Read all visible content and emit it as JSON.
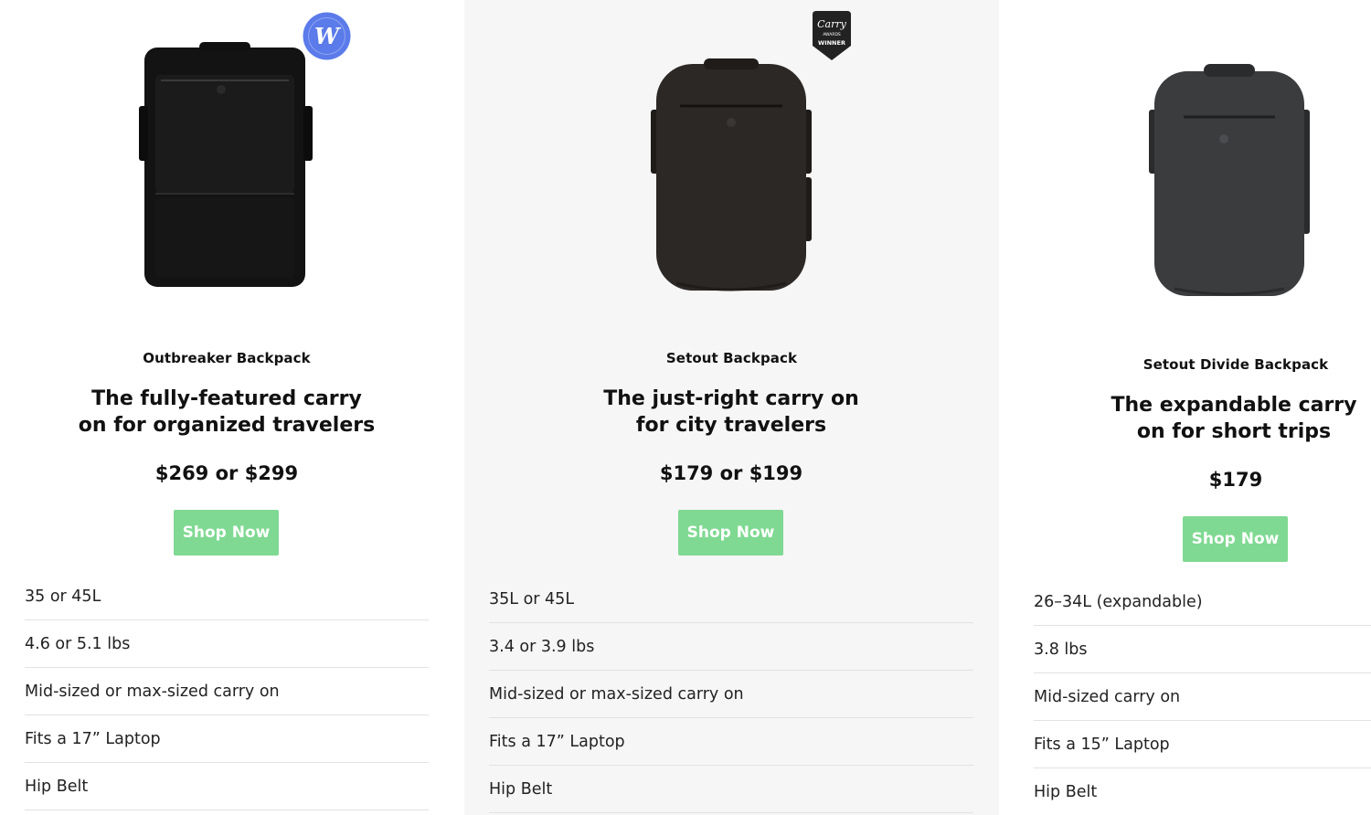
{
  "products": [
    {
      "name": "Outbreaker Backpack",
      "tagline": "The fully-featured carry on for organized travelers",
      "price": "$269 or $299",
      "button": "Shop Now",
      "badge": "W",
      "badge_icon": "award-w-icon",
      "specs": [
        "35 or 45L",
        "4.6 or 5.1 lbs",
        "Mid-sized or max-sized carry on",
        "Fits a 17” Laptop",
        "Hip Belt"
      ]
    },
    {
      "name": "Setout Backpack",
      "tagline": "The just-right carry on for city travelers",
      "price": "$179 or $199",
      "button": "Shop Now",
      "badge": {
        "line1": "Carry",
        "line2": "AWARDS",
        "line3": "WINNER"
      },
      "badge_icon": "carry-awards-shield-icon",
      "specs": [
        "35L or 45L",
        "3.4 or 3.9 lbs",
        "Mid-sized or max-sized carry on",
        "Fits a 17” Laptop",
        "Hip Belt"
      ]
    },
    {
      "name": "Setout Divide Backpack",
      "tagline": "The expandable carry on for short trips",
      "price": "$179",
      "button": "Shop Now",
      "specs": [
        "26–34L (expandable)",
        "3.8 lbs",
        "Mid-sized carry on",
        "Fits a 15” Laptop",
        "Hip Belt"
      ]
    }
  ],
  "colors": {
    "button": "#7fd992",
    "middle_column_bg": "#f6f6f6",
    "divider": "#e2e2e2",
    "badge_blue": "#5b7bea",
    "backpack_black": "#131313",
    "backpack_brown": "#2b2826",
    "backpack_grey": "#3b3c3e"
  }
}
